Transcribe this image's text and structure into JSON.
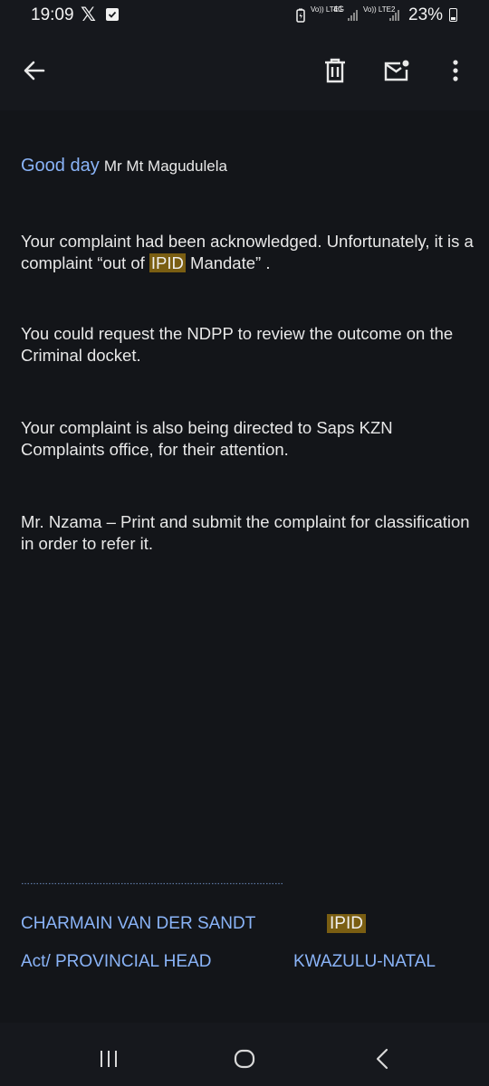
{
  "status_bar": {
    "time": "19:09",
    "sim1_label": "Vo)) LTE1",
    "sim1_tech": "4G",
    "sim2_label": "Vo)) LTE2",
    "battery": "23%",
    "icons": [
      "x-icon",
      "check-icon",
      "sim1-signal-icon",
      "sim2-signal-icon",
      "battery-icon"
    ]
  },
  "toolbar": {
    "icons": [
      "back-arrow-icon",
      "trash-icon",
      "mark-unread-icon",
      "more-vert-icon"
    ]
  },
  "email": {
    "greeting_salute": "Good day",
    "greeting_name": "Mr Mt Magudulela",
    "p1_before": "Your complaint had been acknowledged.  Unfortunately, it is a complaint “out of ",
    "p1_highlight": "IPID",
    "p1_after": " Mandate” .",
    "p2": "You could request the NDPP to review the outcome on the Criminal docket.",
    "p3": "Your complaint is also being directed to Saps KZN Complaints office, for their attention.",
    "p4": "Mr. Nzama – Print and submit the complaint for classification in order to refer it.",
    "signature_line": "…………………………………………………………………………………………………………………………………………………………",
    "sig_name": "CHARMAIN VAN DER SANDT",
    "sig_org": "IPID",
    "sig_title": "Act/ PROVINCIAL HEAD",
    "sig_region": "KWAZULU-NATAL"
  },
  "colors": {
    "background": "#131519",
    "text": "#e8e8e8",
    "link": "#8ab4f8",
    "highlight": "#7a5e12"
  },
  "nav_bar": {
    "icons": [
      "recent-apps-icon",
      "home-icon",
      "back-icon"
    ]
  }
}
